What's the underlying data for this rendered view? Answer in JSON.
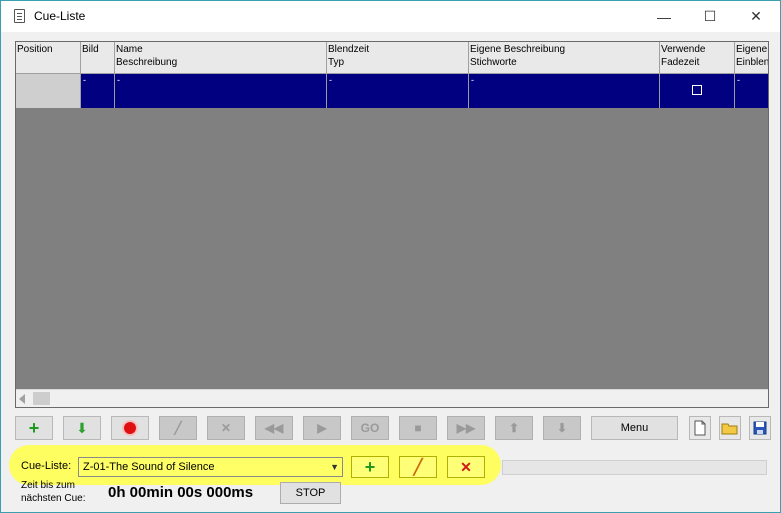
{
  "window": {
    "title": "Cue-Liste",
    "minimize": "—",
    "maximize": "☐",
    "close": "✕"
  },
  "grid": {
    "headers": [
      [
        "Position",
        ""
      ],
      [
        "Bild",
        ""
      ],
      [
        "Name",
        "Beschreibung"
      ],
      [
        "Blendzeit",
        "Typ"
      ],
      [
        "Eigene Beschreibung",
        "Stichworte"
      ],
      [
        "Verwende",
        "Fadezeit"
      ],
      [
        "Eigene",
        "Einblen"
      ]
    ],
    "row": [
      "-",
      "-",
      "-",
      "-",
      "",
      "-"
    ],
    "row_checkbox_checked": false
  },
  "toolbar": {
    "add_icon": "+",
    "down_icon": "⬇",
    "record_icon": "●",
    "edit_icon": "╱",
    "delete_icon": "✕",
    "rewind_icon": "◀◀",
    "play_icon": "▶",
    "go_label": "GO",
    "stop_icon": "■",
    "forward_icon": "▶▶",
    "up_icon": "⬆",
    "down2_icon": "⬇",
    "menu_label": "Menu"
  },
  "footer": {
    "cue_list_label": "Cue-Liste:",
    "cue_list_value": "Z-01-The Sound of Silence",
    "time_label_line1": "Zeit bis zum",
    "time_label_line2": "nächsten Cue:",
    "time_value": "0h 00min 00s 000ms",
    "stop_label": "STOP",
    "add_icon": "+",
    "edit_icon": "╱",
    "delete_icon": "✕"
  },
  "colors": {
    "selection": "#000080",
    "highlight": "#ffff55",
    "grid_bg": "#808080"
  }
}
